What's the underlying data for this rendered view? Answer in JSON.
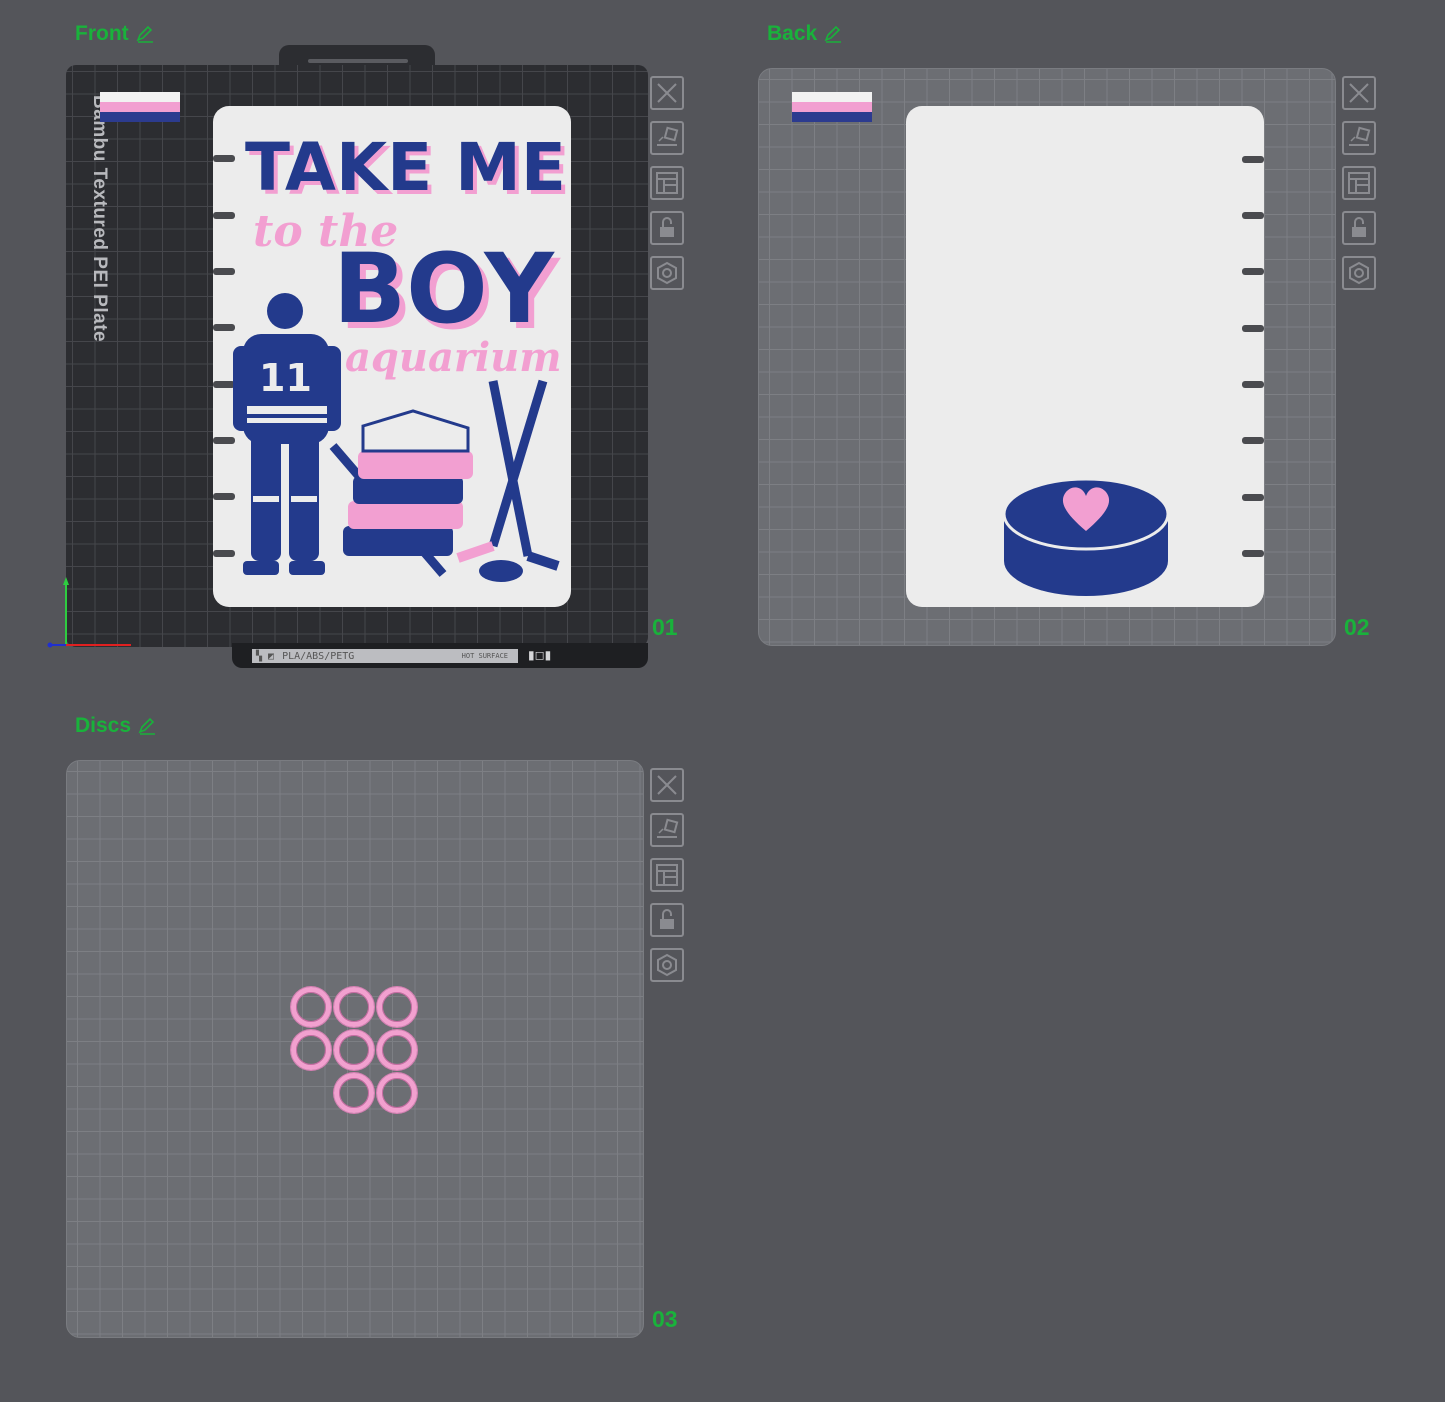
{
  "plates": [
    {
      "id": "front",
      "title": "Front",
      "number": "01"
    },
    {
      "id": "back",
      "title": "Back",
      "number": "02"
    },
    {
      "id": "discs",
      "title": "Discs",
      "number": "03"
    }
  ],
  "plate_type_label": "Bambu Textured PEI Plate",
  "strip_text": "PLA/ABS/PETG",
  "strip_hot": "HOT SURFACE",
  "filament_colors": [
    "#f2f2f2",
    "#f29fd1",
    "#2c3b8f"
  ],
  "artwork": {
    "line1": "TAKE ME",
    "line2": "to the",
    "line3": "BOY",
    "line4": "aquarium",
    "jersey_number": "11"
  },
  "tools": [
    "close-icon",
    "auto-orient-icon",
    "arrange-icon",
    "lock-icon",
    "settings-icon"
  ],
  "colors": {
    "accent": "#19b23b",
    "navy": "#233a8c",
    "pink": "#f29fd1"
  }
}
